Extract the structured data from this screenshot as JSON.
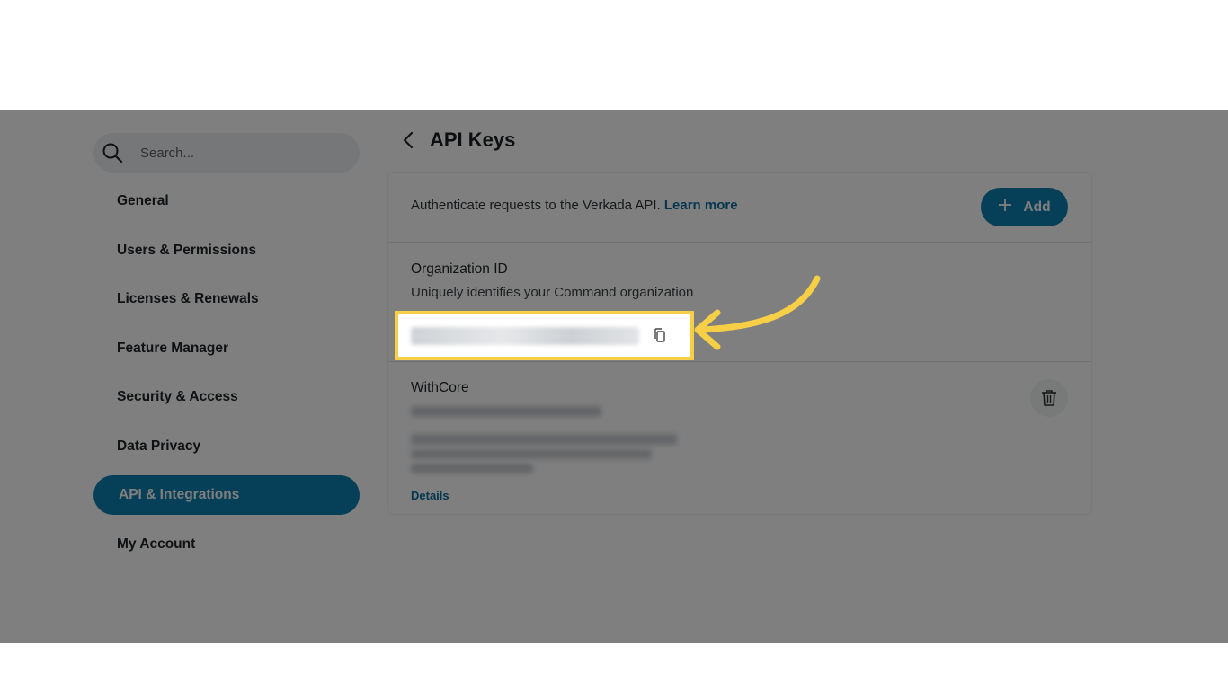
{
  "sidebar": {
    "search_placeholder": "Search...",
    "items": [
      {
        "label": "General"
      },
      {
        "label": "Users & Permissions"
      },
      {
        "label": "Licenses & Renewals"
      },
      {
        "label": "Feature Manager"
      },
      {
        "label": "Security & Access"
      },
      {
        "label": "Data Privacy"
      },
      {
        "label": "API & Integrations",
        "active": true
      },
      {
        "label": "My Account"
      }
    ]
  },
  "header": {
    "title": "API Keys"
  },
  "intro": {
    "text": "Authenticate requests to the Verkada API. ",
    "link": "Learn more"
  },
  "add_button": {
    "label": "Add"
  },
  "organization": {
    "label": "Organization ID",
    "description": "Uniquely identifies your Command organization"
  },
  "api_key": {
    "name": "WithCore",
    "details_link": "Details"
  },
  "colors": {
    "accent": "#0b7fb0",
    "highlight": "#f7cf47",
    "link": "#0b6fa3"
  },
  "icons": [
    "search-icon",
    "chevron-left-icon",
    "plus-icon",
    "copy-icon",
    "trash-icon",
    "curved-arrow-icon"
  ]
}
